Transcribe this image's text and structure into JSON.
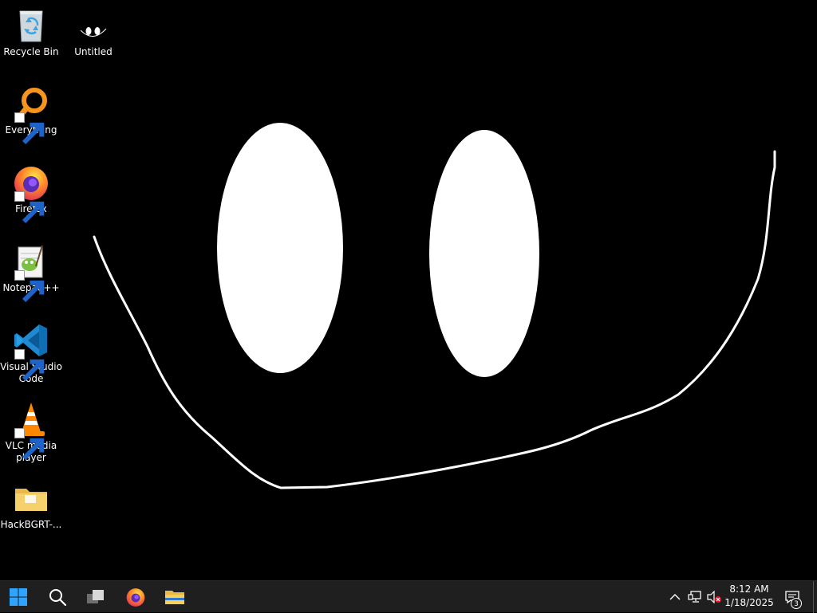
{
  "desktop": {
    "background_color": "#000000",
    "icons": [
      {
        "label": "Recycle Bin",
        "icon": "recycle-bin-icon",
        "shortcut": false
      },
      {
        "label": "Untitled",
        "icon": "untitled-image-icon",
        "shortcut": false
      },
      {
        "label": "Everything",
        "icon": "everything-search-icon",
        "shortcut": true
      },
      {
        "label": "Firefox",
        "icon": "firefox-icon",
        "shortcut": true
      },
      {
        "label": "Notepad++",
        "icon": "notepad-plus-plus-icon",
        "shortcut": true
      },
      {
        "label": "Visual Studio Code",
        "icon": "vscode-icon",
        "shortcut": true
      },
      {
        "label": "VLC media player",
        "icon": "vlc-icon",
        "shortcut": true
      },
      {
        "label": "HackBGRT-...",
        "icon": "folder-icon",
        "shortcut": false
      }
    ]
  },
  "taskbar": {
    "background_color": "#1f1f1f",
    "pinned": [
      {
        "name": "Start",
        "icon": "windows-start-icon"
      },
      {
        "name": "Search",
        "icon": "search-icon"
      },
      {
        "name": "Task View",
        "icon": "task-view-icon"
      },
      {
        "name": "Firefox",
        "icon": "firefox-icon"
      },
      {
        "name": "File Explorer",
        "icon": "file-explorer-icon"
      }
    ],
    "tray": {
      "icons": [
        "chevron-up-icon",
        "network-icon",
        "volume-muted-icon"
      ],
      "time": "8:12 AM",
      "date": "1/18/2025",
      "notification_count": "3"
    }
  }
}
